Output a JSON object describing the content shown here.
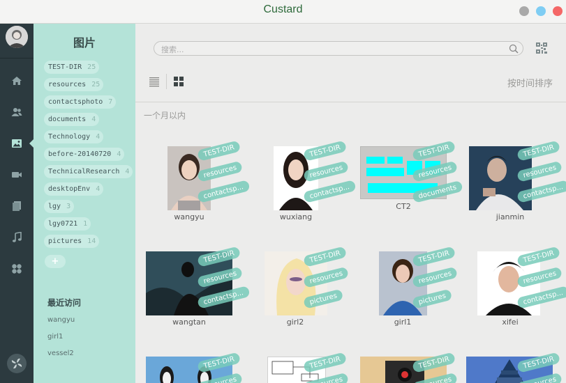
{
  "window": {
    "title": "Custard"
  },
  "rail": {
    "items": [
      "home-icon",
      "contacts-icon",
      "pictures-icon",
      "video-icon",
      "documents-icon",
      "music-icon",
      "apps-icon"
    ],
    "active": "pictures-icon"
  },
  "sidebar": {
    "title": "图片",
    "tags": [
      {
        "label": "TEST-DIR",
        "count": "25"
      },
      {
        "label": "resources",
        "count": "25"
      },
      {
        "label": "contactsphoto",
        "count": "7"
      },
      {
        "label": "documents",
        "count": "4"
      },
      {
        "label": "Technology",
        "count": "4"
      },
      {
        "label": "before-20140720",
        "count": "4"
      },
      {
        "label": "TechnicalResearch",
        "count": "4"
      },
      {
        "label": "desktopEnv",
        "count": "4"
      },
      {
        "label": "lgy",
        "count": "3"
      },
      {
        "label": "lgy0721",
        "count": "1"
      },
      {
        "label": "pictures",
        "count": "14"
      }
    ],
    "add_label": "+",
    "recent_title": "最近访问",
    "recent": [
      "wangyu",
      "girl1",
      "vessel2"
    ]
  },
  "search": {
    "placeholder": "搜索..."
  },
  "toolbar": {
    "sort_label": "按时间排序"
  },
  "section_title": "一个月以内",
  "grid": [
    {
      "caption": "wangyu",
      "tags": [
        "TEST-DIR",
        "resources",
        "contactsp..."
      ]
    },
    {
      "caption": "wuxiang",
      "tags": [
        "TEST-DIR",
        "resources",
        "contactsp..."
      ]
    },
    {
      "caption": "CT2",
      "tags": [
        "TEST-DIR",
        "resources",
        "documents"
      ]
    },
    {
      "caption": "jianmin",
      "tags": [
        "TEST-DIR",
        "resources",
        "contactsp..."
      ]
    },
    {
      "caption": "wangtan",
      "tags": [
        "TEST-DIR",
        "resources",
        "contactsp..."
      ]
    },
    {
      "caption": "girl2",
      "tags": [
        "TEST-DIR",
        "resources",
        "pictures"
      ]
    },
    {
      "caption": "girl1",
      "tags": [
        "TEST-DIR",
        "resources",
        "pictures"
      ]
    },
    {
      "caption": "xifei",
      "tags": [
        "TEST-DIR",
        "resources",
        "contactsp..."
      ]
    },
    {
      "caption": "",
      "tags": [
        "TEST-DIR",
        "resources"
      ]
    },
    {
      "caption": "",
      "tags": [
        "TEST-DIR",
        "resources"
      ]
    },
    {
      "caption": "",
      "tags": [
        "TEST-DIR",
        "resources"
      ]
    },
    {
      "caption": "",
      "tags": [
        "TEST-DIR",
        "resources"
      ]
    }
  ],
  "colors": {
    "accent": "#b4e3d8",
    "chip": "#78cbba",
    "rail": "#2c3a3f",
    "title": "#2e6a3b"
  }
}
